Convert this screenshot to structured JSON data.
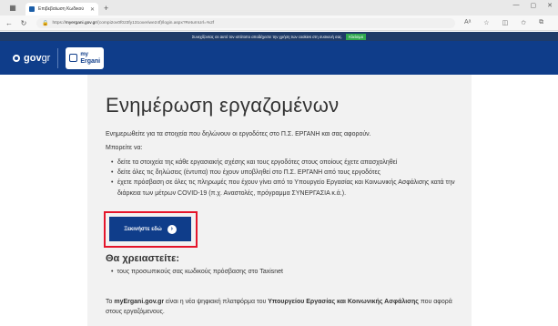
{
  "browser": {
    "tab_title": "Επιβεβαίωση Κωδικού",
    "url_host": "myergani.gov.gr",
    "url_rest": "/(compi2ov0f023fy131oxeriwe24f)/login.aspx?ReturnUrl=%2f",
    "new_tab": "+"
  },
  "cookie": {
    "text": "Συνεχίζοντας σε αυτό τον ιστότοπο αποδέχεστε την χρήση των cookies στη συσκευή σας.",
    "ok": "Κλείσιμο"
  },
  "header": {
    "gov_a": "gov",
    "gov_b": "gr",
    "brand_my": "my",
    "brand_ergani": "Ergani"
  },
  "main": {
    "title": "Ενημέρωση εργαζομένων",
    "lead": "Ενημερωθείτε για τα στοιχεία που δηλώνουν οι εργοδότες στο Π.Σ. ΕΡΓΑΝΗ και σας αφορούν.",
    "can": "Μπορείτε να:",
    "bullets": [
      "δείτε τα στοιχεία της κάθε εργασιακής σχέσης και τους εργοδότες στους οποίους έχετε απασχοληθεί",
      "δείτε όλες τις δηλώσεις (έντυπα) που έχουν υποβληθεί στο Π.Σ. ΕΡΓΑΝΗ από τους εργοδότες",
      "έχετε πρόσβαση σε όλες τις πληρωμές που έχουν γίνει από το Υπουργείο Εργασίας και Κοινωνικής Ασφάλισης κατά την διάρκεια των μέτρων COVID-19 (π.χ. Αναστολές, πρόγραμμα ΣΥΝΕΡΓΑΣΙΑ κ.ά.)."
    ],
    "start_label": "Ξεκινήστε εδώ",
    "need_title": "Θα χρειαστείτε:",
    "need_item": "τους προσωπικούς σας κωδικούς πρόσβασης στο Taxisnet",
    "foot_1": "Το ",
    "foot_2": "myErgani.gov.gr",
    "foot_3": " είναι η νέα ψηφιακή πλατφόρμα του ",
    "foot_4": "Υπουργείου Εργασίας και Κοινωνικής Ασφάλισης",
    "foot_5": " που αφορά στους εργαζόμενους."
  }
}
